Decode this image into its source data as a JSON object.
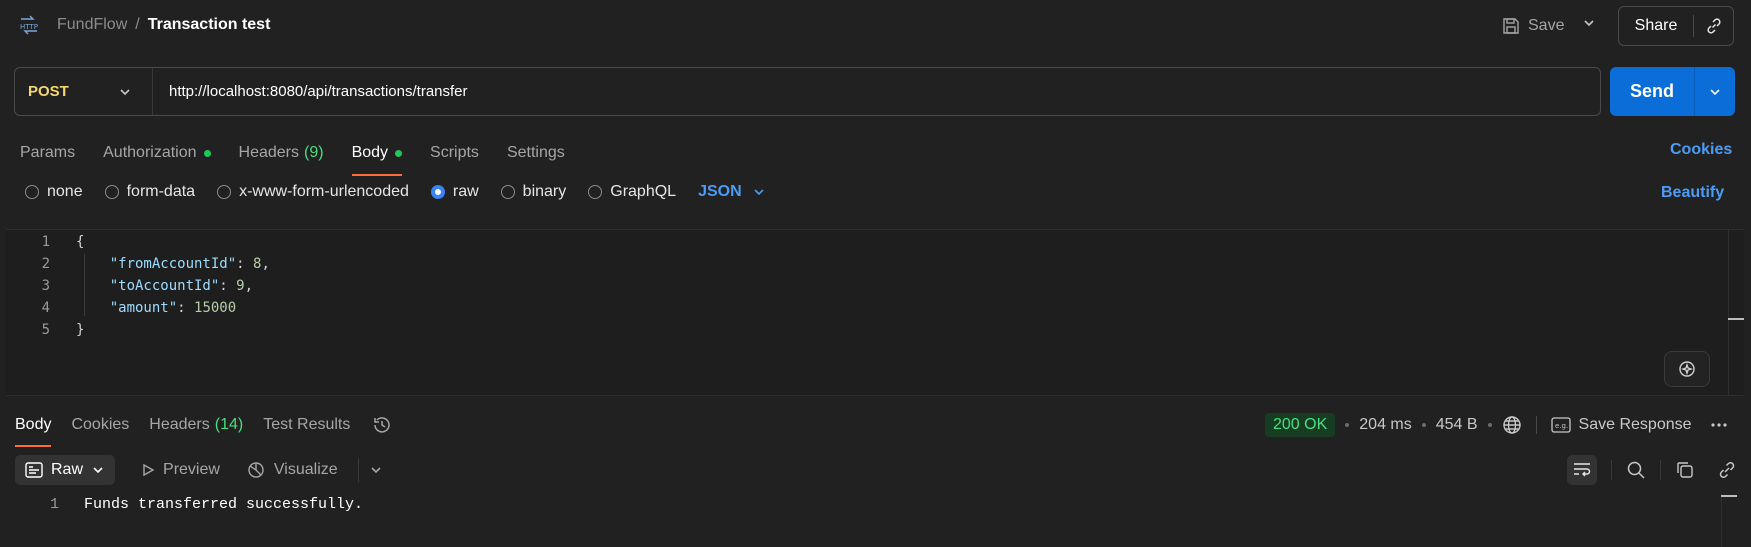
{
  "header": {
    "breadcrumb_parent": "FundFlow",
    "breadcrumb_separator": "/",
    "breadcrumb_current": "Transaction test",
    "save_label": "Save",
    "share_label": "Share"
  },
  "request": {
    "method": "POST",
    "url": "http://localhost:8080/api/transactions/transfer",
    "send_label": "Send"
  },
  "request_tabs": {
    "params": "Params",
    "authorization": "Authorization",
    "headers": "Headers",
    "headers_count": "(9)",
    "body": "Body",
    "scripts": "Scripts",
    "settings": "Settings",
    "cookies": "Cookies"
  },
  "body_types": {
    "none": "none",
    "form_data": "form-data",
    "urlencoded": "x-www-form-urlencoded",
    "raw": "raw",
    "binary": "binary",
    "graphql": "GraphQL",
    "language": "JSON",
    "beautify": "Beautify"
  },
  "editor": {
    "lines": [
      {
        "num": "1",
        "open": "{"
      },
      {
        "num": "2",
        "key": "\"fromAccountId\"",
        "value": "8",
        "trail": ","
      },
      {
        "num": "3",
        "key": "\"toAccountId\"",
        "value": "9",
        "trail": ","
      },
      {
        "num": "4",
        "key": "\"amount\"",
        "value": "15000",
        "trail": ""
      },
      {
        "num": "5",
        "close": "}"
      }
    ]
  },
  "response_tabs": {
    "body": "Body",
    "cookies": "Cookies",
    "headers": "Headers",
    "headers_count": "(14)",
    "test_results": "Test Results"
  },
  "response_meta": {
    "status": "200 OK",
    "time": "204 ms",
    "size": "454 B",
    "save_response": "Save Response"
  },
  "response_toolbar": {
    "raw": "Raw",
    "preview": "Preview",
    "visualize": "Visualize"
  },
  "response_body": {
    "line_num": "1",
    "text": "Funds transferred successfully."
  },
  "colors": {
    "background": "#212121",
    "accent_blue": "#0b6dd8",
    "method_yellow": "#f5d76e",
    "active_tab_underline": "#ff6c37",
    "status_green": "#4ade80"
  }
}
